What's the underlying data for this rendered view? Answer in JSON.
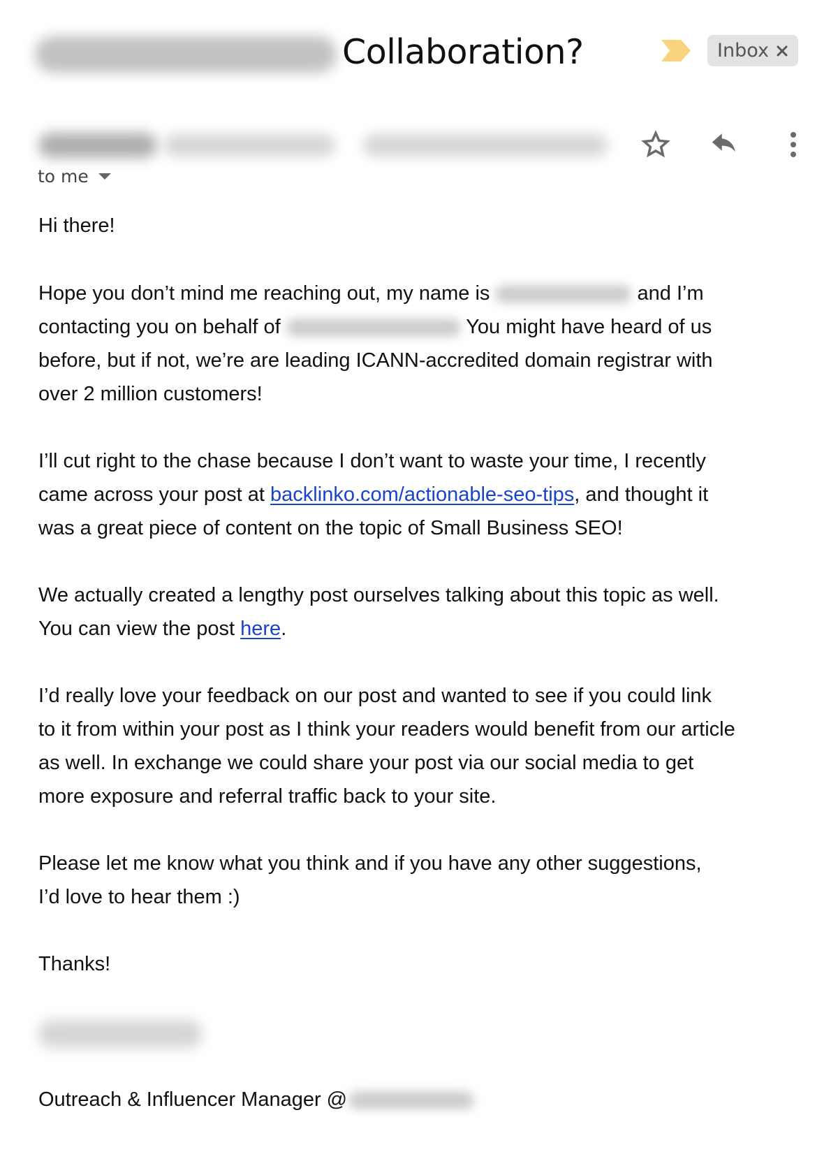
{
  "header": {
    "subject_redacted": "[redacted domain]",
    "subject": "Collaboration?",
    "importance_marker_icon": "importance-marker-icon",
    "importance_color": "#f8d47e",
    "label_chip": {
      "label": "Inbox",
      "remove_icon": "close-icon"
    }
  },
  "sender": {
    "name_redacted": "[redacted sender name]",
    "email_redacted": "[redacted sender email]",
    "timestamp_redacted": "[redacted timestamp]",
    "recipient_label": "to me",
    "actions": [
      "star-icon",
      "reply-icon",
      "more-vert-icon"
    ]
  },
  "body": {
    "greeting": "Hi there!",
    "p1": {
      "l1a": "Hope you don’t mind me reaching out, my name is",
      "l1b": "and I’m",
      "l2a": "contacting you on behalf of",
      "l2b": "You might have heard of us",
      "l3": "before, but if not, we’re are leading ICANN-accredited domain registrar with",
      "l4": "over 2 million customers!"
    },
    "p2": {
      "l1": "I’ll cut right to the chase because I don’t want to waste your time, I recently",
      "l2a": "came across your post at",
      "link": "backlinko.com/actionable-seo-tips",
      "l2b": ", and thought it",
      "l3": "was a great piece of content on the topic of Small Business SEO!"
    },
    "p3": {
      "l1": "We actually created a lengthy post ourselves talking about this topic as well.",
      "l2a": "You can view the post",
      "link": "here",
      "l2b": "."
    },
    "p4": {
      "l1": "I’d really love your feedback on our post and wanted to see if you could link",
      "l2": "to it from within your post as I think your readers would benefit from our article",
      "l3": "as well. In exchange we could share your post via our social media to get",
      "l4": "more exposure and referral traffic back to your site."
    },
    "p5": {
      "l1": "Please let me know what you think and if you have any other suggestions,",
      "l2": "I’d love to hear them :)"
    },
    "signoff": "Thanks!",
    "signature_name_redacted": "[redacted name]",
    "signature_title": "Outreach & Influencer Manager @",
    "signature_company_redacted": "[redacted company]"
  },
  "colors": {
    "link": "#1a44c7",
    "chip_bg": "#e3e3e3",
    "icon_gray": "#5f6368"
  }
}
